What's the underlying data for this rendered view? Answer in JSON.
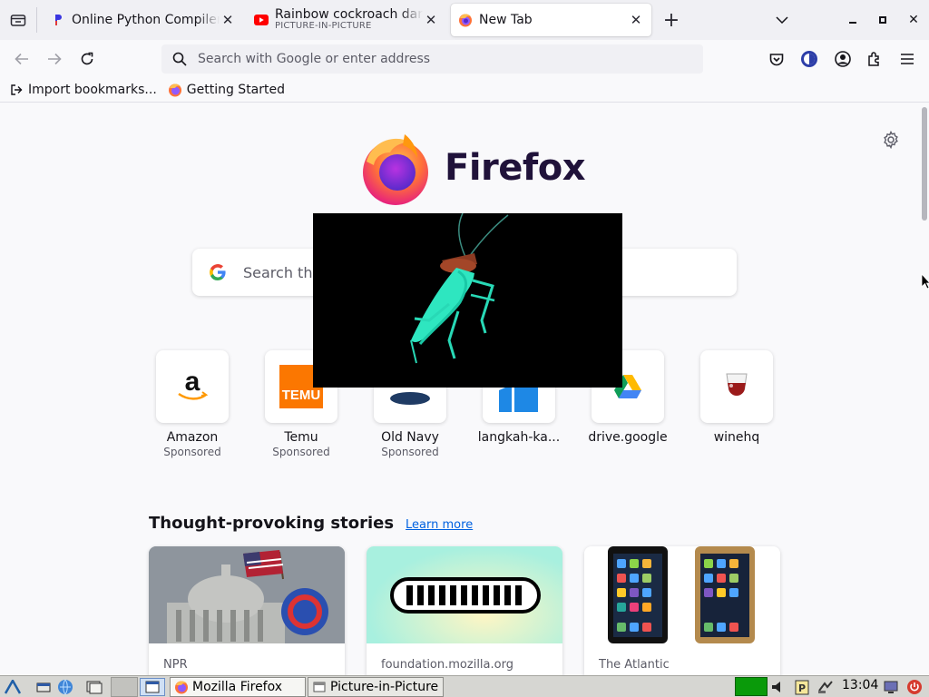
{
  "browser": {
    "tabs": [
      {
        "title": "Online Python Compiler",
        "active": false
      },
      {
        "title": "Rainbow cockroach danc",
        "subtitle": "PICTURE-IN-PICTURE",
        "active": false
      },
      {
        "title": "New Tab",
        "active": true
      }
    ],
    "address_bar": {
      "placeholder": "Search with Google or enter address",
      "value": ""
    },
    "bookmarks": [
      {
        "label": "Import bookmarks..."
      },
      {
        "label": "Getting Started"
      }
    ]
  },
  "newtab": {
    "brand": "Firefox",
    "search_placeholder": "Search the web",
    "shortcuts": [
      {
        "name": "Amazon",
        "sponsored": "Sponsored"
      },
      {
        "name": "Temu",
        "sponsored": "Sponsored"
      },
      {
        "name": "Old Navy",
        "sponsored": "Sponsored"
      },
      {
        "name": "langkah-ka...",
        "sponsored": ""
      },
      {
        "name": "drive.google",
        "sponsored": ""
      },
      {
        "name": "winehq",
        "sponsored": ""
      }
    ],
    "stories": {
      "heading": "Thought-provoking stories",
      "learn_more": "Learn more",
      "cards": [
        {
          "source": "NPR"
        },
        {
          "source": "foundation.mozilla.org"
        },
        {
          "source": "The Atlantic"
        }
      ]
    }
  },
  "taskbar": {
    "tasks": [
      {
        "label": "Mozilla Firefox",
        "active": true
      },
      {
        "label": "Picture-in-Picture",
        "active": false
      }
    ],
    "clock": "13:04"
  },
  "colors": {
    "accent_link": "#0061e0",
    "tab_strip": "#f0f0f4",
    "firefox_wordmark": "#20123a",
    "pip_background": "#000000",
    "roach": "#2ee6c0"
  },
  "icons": [
    "tab-list-icon",
    "youtube-icon",
    "firefox-icon",
    "back-icon",
    "forward-icon",
    "reload-icon",
    "search-icon",
    "pocket-icon",
    "vpn-icon",
    "account-icon",
    "extensions-icon",
    "menu-icon",
    "import-icon",
    "gear-icon",
    "google-icon"
  ]
}
